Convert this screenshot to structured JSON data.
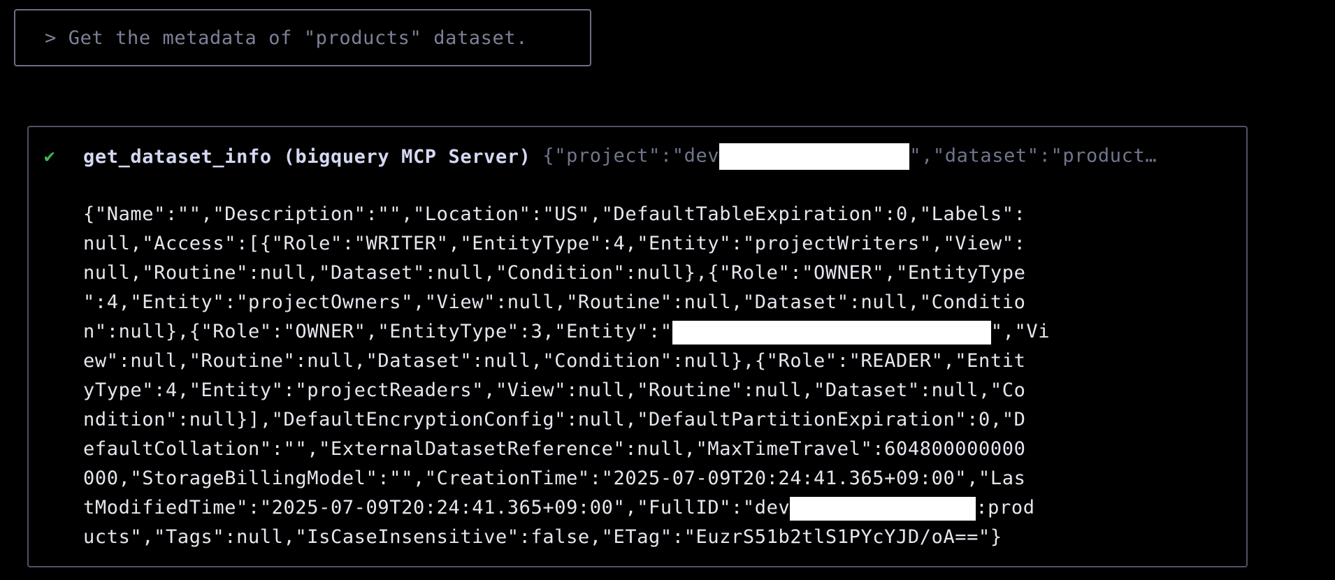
{
  "prompt": {
    "text": "> Get the metadata of \"products\" dataset."
  },
  "tool_call": {
    "status_icon": "check-icon",
    "status_color": "#3fb950",
    "name": "get_dataset_info (bigquery MCP Server)",
    "args_before_redaction": "{\"project\":\"dev",
    "args_after_redaction": "\",\"dataset\":\"product…",
    "output_lines": [
      "{\"Name\":\"\",\"Description\":\"\",\"Location\":\"US\",\"DefaultTableExpiration\":0,\"Labels\":",
      "null,\"Access\":[{\"Role\":\"WRITER\",\"EntityType\":4,\"Entity\":\"projectWriters\",\"View\":",
      "null,\"Routine\":null,\"Dataset\":null,\"Condition\":null},{\"Role\":\"OWNER\",\"EntityType",
      "\":4,\"Entity\":\"projectOwners\",\"View\":null,\"Routine\":null,\"Dataset\":null,\"Conditio",
      {
        "before": "n\":null},{\"Role\":\"OWNER\",\"EntityType\":3,\"Entity\":\"",
        "after": "\",\"Vi"
      },
      "ew\":null,\"Routine\":null,\"Dataset\":null,\"Condition\":null},{\"Role\":\"READER\",\"Entit",
      "yType\":4,\"Entity\":\"projectReaders\",\"View\":null,\"Routine\":null,\"Dataset\":null,\"Co",
      "ndition\":null}],\"DefaultEncryptionConfig\":null,\"DefaultPartitionExpiration\":0,\"D",
      "efaultCollation\":\"\",\"ExternalDatasetReference\":null,\"MaxTimeTravel\":604800000000",
      "000,\"StorageBillingModel\":\"\",\"CreationTime\":\"2025-07-09T20:24:41.365+09:00\",\"Las",
      {
        "before": "tModifiedTime\":\"2025-07-09T20:24:41.365+09:00\",\"FullID\":\"dev",
        "after": ":prod"
      },
      "ucts\",\"Tags\":null,\"IsCaseInsensitive\":false,\"ETag\":\"EuzrS51b2tlS1PYcYJD/oA==\"}"
    ]
  }
}
